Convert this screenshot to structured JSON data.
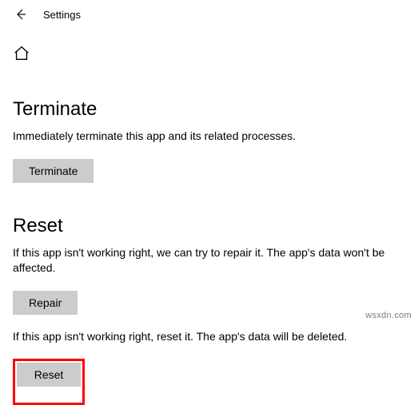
{
  "header": {
    "title": "Settings"
  },
  "terminate": {
    "heading": "Terminate",
    "description": "Immediately terminate this app and its related processes.",
    "button": "Terminate"
  },
  "reset": {
    "heading": "Reset",
    "repair_description": "If this app isn't working right, we can try to repair it. The app's data won't be affected.",
    "repair_button": "Repair",
    "reset_description": "If this app isn't working right, reset it. The app's data will be deleted.",
    "reset_button": "Reset"
  },
  "watermark": "wsxdn.com"
}
